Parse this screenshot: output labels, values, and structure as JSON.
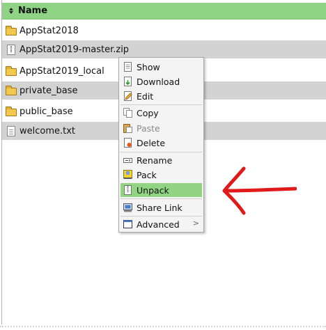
{
  "header": {
    "name_label": "Name"
  },
  "files": [
    {
      "name": "AppStat2018",
      "type": "folder",
      "icon": "folder-icon"
    },
    {
      "name": "AppStat2019-master.zip",
      "type": "zip",
      "icon": "zip-file-icon"
    },
    {
      "name": "AppStat2019_local",
      "type": "folder",
      "icon": "folder-icon"
    },
    {
      "name": "private_base",
      "type": "folder",
      "icon": "folder-icon"
    },
    {
      "name": "public_base",
      "type": "folder",
      "icon": "folder-icon"
    },
    {
      "name": "welcome.txt",
      "type": "text",
      "icon": "text-file-icon"
    }
  ],
  "context_menu": {
    "items": [
      {
        "label": "Show",
        "icon": "show-icon",
        "enabled": true
      },
      {
        "label": "Download",
        "icon": "download-icon",
        "enabled": true
      },
      {
        "label": "Edit",
        "icon": "edit-icon",
        "enabled": true
      },
      {
        "label": "Copy",
        "icon": "copy-icon",
        "enabled": true
      },
      {
        "label": "Paste",
        "icon": "paste-icon",
        "enabled": false
      },
      {
        "label": "Delete",
        "icon": "delete-icon",
        "enabled": true
      },
      {
        "label": "Rename",
        "icon": "rename-icon",
        "enabled": true
      },
      {
        "label": "Pack",
        "icon": "pack-icon",
        "enabled": true
      },
      {
        "label": "Unpack",
        "icon": "unpack-icon",
        "enabled": true,
        "highlighted": true
      },
      {
        "label": "Share Link",
        "icon": "share-link-icon",
        "enabled": true
      },
      {
        "label": "Advanced",
        "icon": "advanced-icon",
        "enabled": true,
        "submenu_indicator": ">"
      }
    ]
  },
  "colors": {
    "header_bg": "#8fd484",
    "highlight_bg": "#90d484",
    "alt_row_bg": "#d3d3d3",
    "arrow": "#e01a1a"
  }
}
